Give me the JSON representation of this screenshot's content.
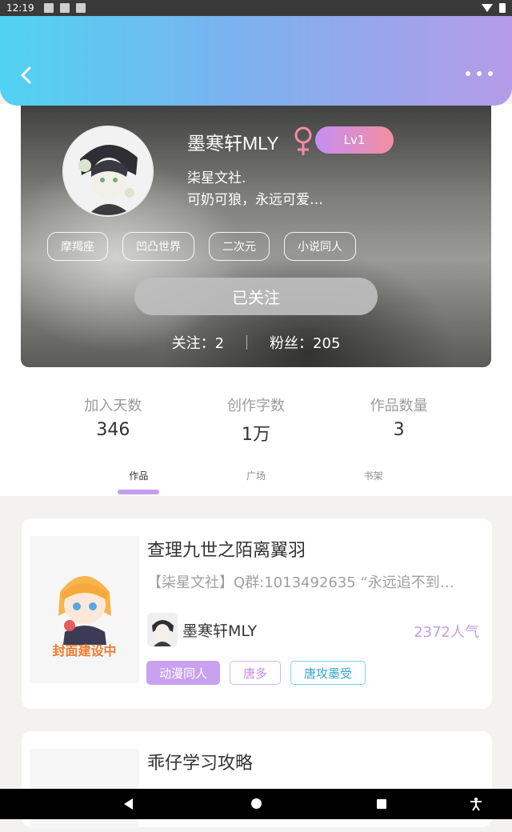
{
  "status_bar": {
    "time": "12:19"
  },
  "profile": {
    "nickname": "墨寒轩MLY",
    "gender_symbol": "♀",
    "level": "Lv1",
    "bio_line1": "柒星文社.",
    "bio_line2": "可奶可狼，永远可爱…",
    "tags": [
      "摩羯座",
      "凹凸世界",
      "二次元",
      "小说同人"
    ],
    "follow_button": "已关注",
    "following": "关注：2",
    "fans": "粉丝：205"
  },
  "stats": [
    {
      "label": "加入天数",
      "value": "346"
    },
    {
      "label": "创作字数",
      "value": "1万"
    },
    {
      "label": "作品数量",
      "value": "3"
    }
  ],
  "tabs": [
    {
      "label": "作品",
      "active": true
    },
    {
      "label": "广场",
      "active": false
    },
    {
      "label": "书架",
      "active": false
    }
  ],
  "works": [
    {
      "title": "查理九世之陌离翼羽",
      "description": "【柒星文社】Q群:1013492635 “永远追不到…",
      "cover_text": "封面建设中",
      "author": "墨寒轩MLY",
      "popularity": "2372人气",
      "tags": [
        "动漫同人",
        "唐多",
        "唐攻墨受"
      ]
    },
    {
      "title": "乖仔学习攻略"
    }
  ],
  "colors": {
    "accent_purple": "#c9a2ef",
    "header_gradient_start": "#51d2f2",
    "header_gradient_end": "#b49be8"
  }
}
